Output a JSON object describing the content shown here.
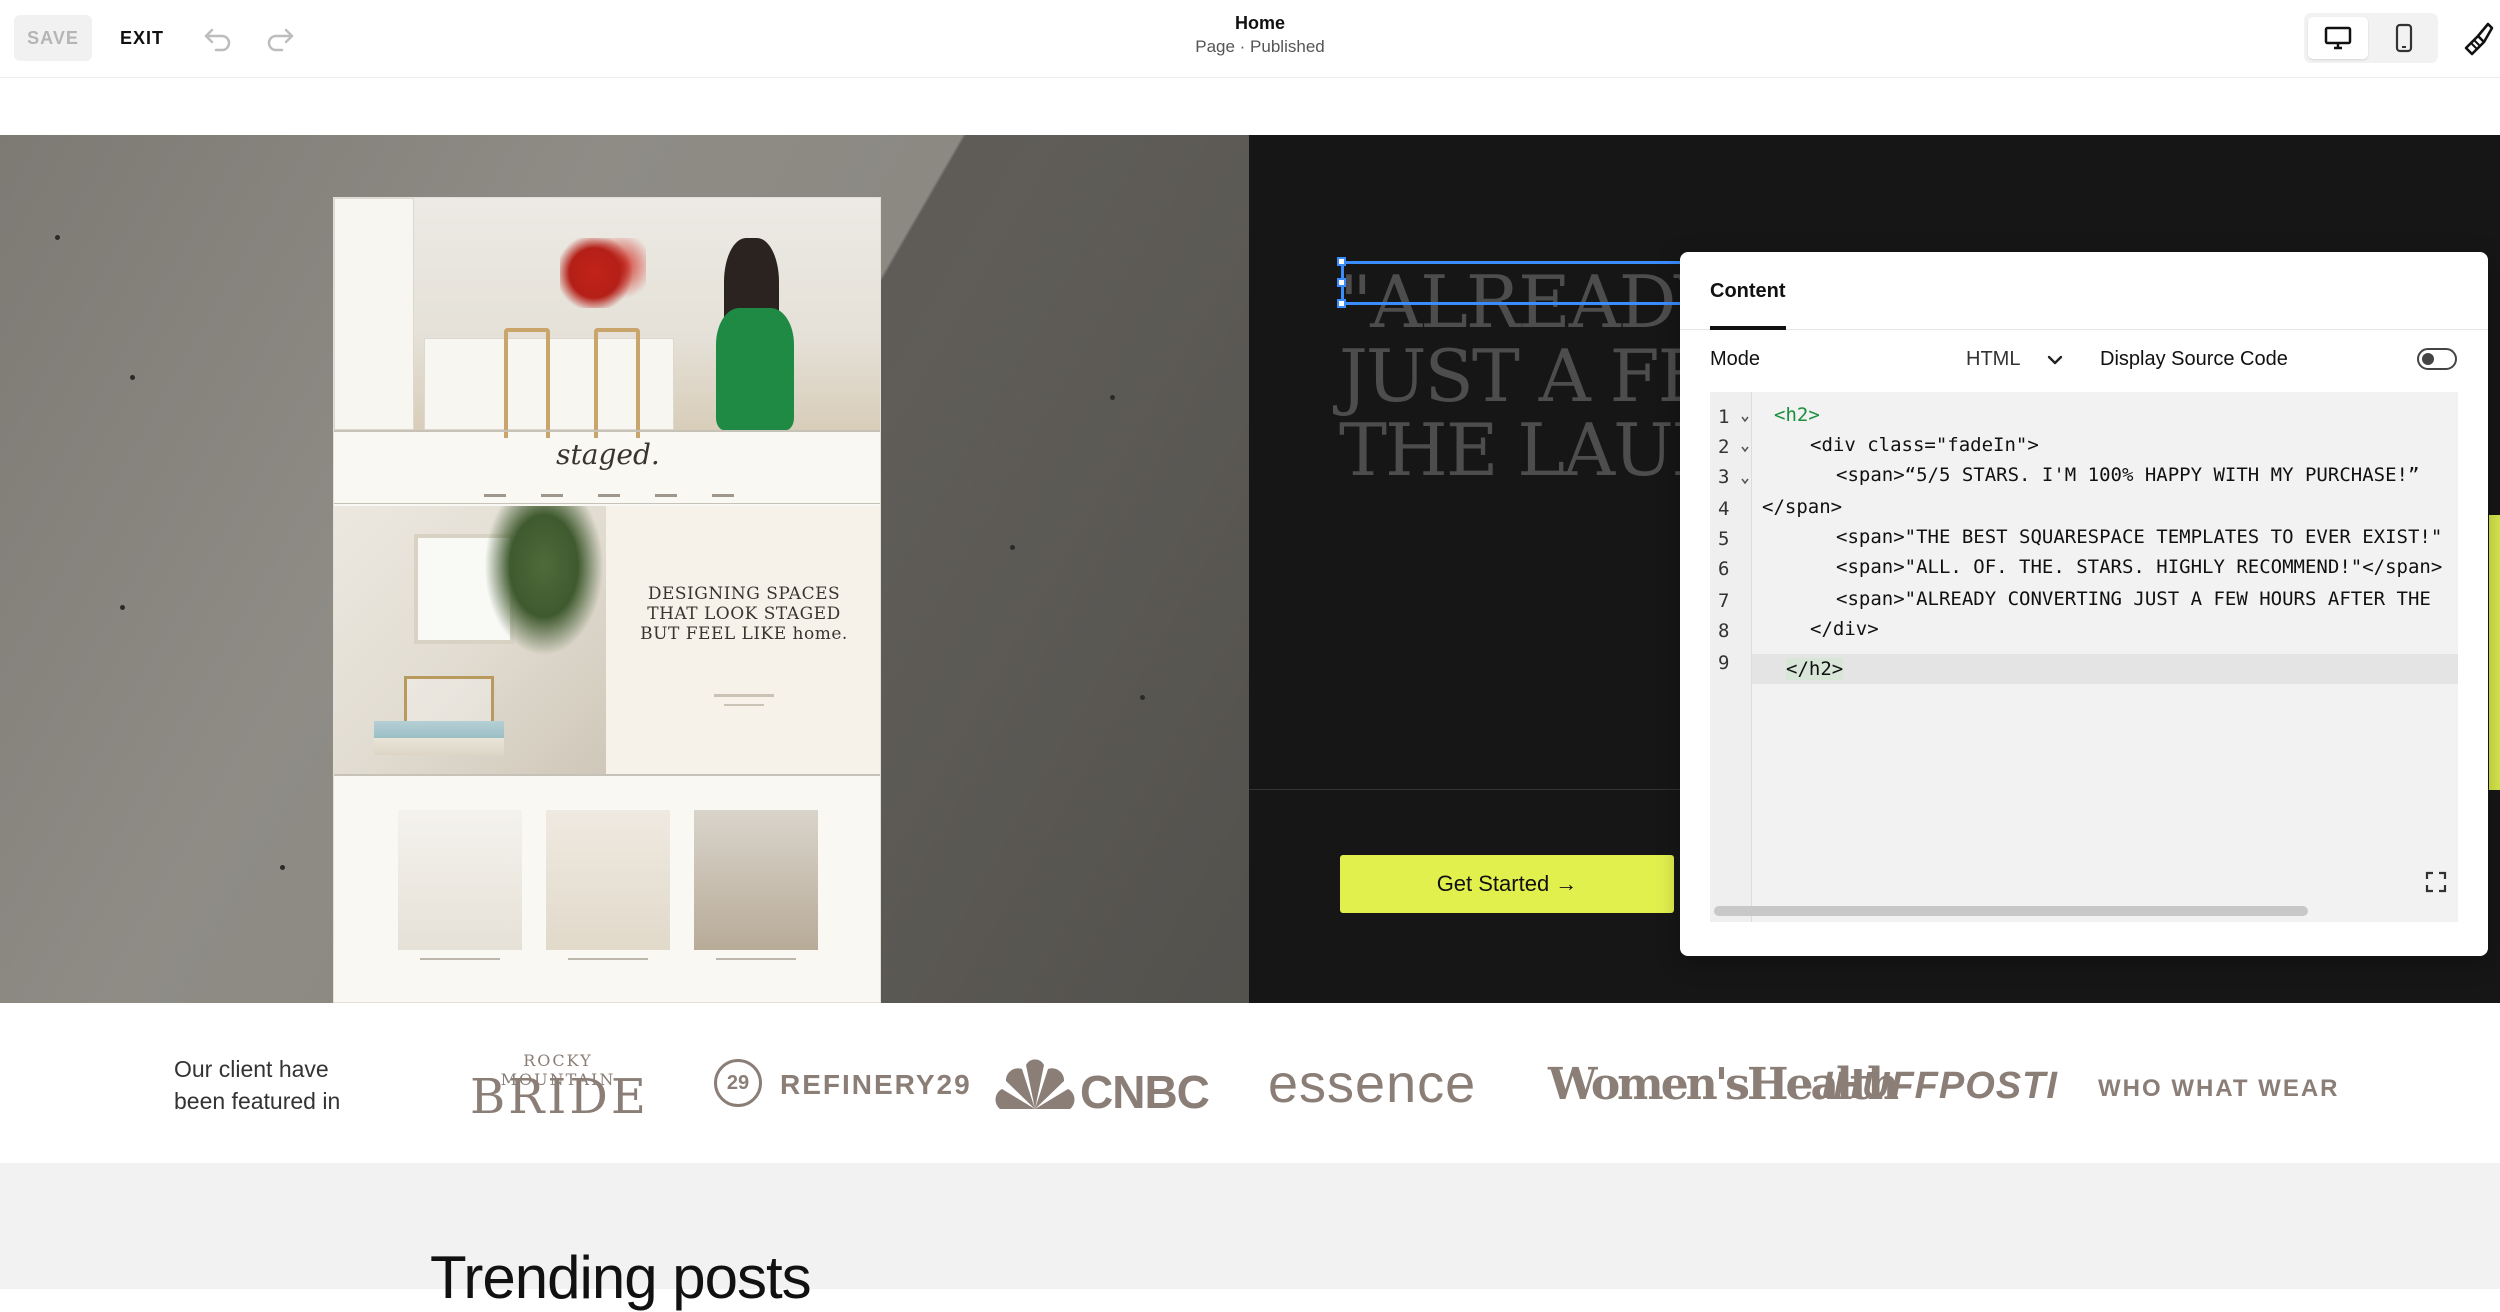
{
  "toolbar": {
    "save_label": "SAVE",
    "exit_label": "EXIT",
    "page_title": "Home",
    "page_status": "Page · Published"
  },
  "hero": {
    "quote": "\"ALREADY\nJUST A FEW\nTHE LAUN",
    "cta_label": "Get Started →",
    "mockup": {
      "logo": "staged.",
      "heading_line1": "DESIGNING SPACES",
      "heading_line2": "THAT LOOK STAGED",
      "heading_line3": "BUT FEEL LIKE home."
    }
  },
  "panel": {
    "tab": "Content",
    "mode_label": "Mode",
    "mode_value": "HTML",
    "source_label": "Display Source Code",
    "source_enabled": false,
    "line_numbers": [
      "1",
      "2",
      "3",
      "4",
      "5",
      "6",
      "7",
      "8",
      "9"
    ],
    "code": [
      "<h2>",
      "<div class=\"fadeIn\">",
      "<span>“5/5 STARS. I'M 100% HAPPY WITH MY PURCHASE!”",
      "</span>",
      "<span>\"THE BEST SQUARESPACE TEMPLATES TO EVER EXIST!\"",
      "<span>\"ALL. OF. THE. STARS. HIGHLY RECOMMEND!\"</span>",
      "<span>\"ALREADY CONVERTING JUST A FEW HOURS AFTER THE",
      "</div>",
      "</h2>"
    ]
  },
  "featured": {
    "label": "Our client have been featured in",
    "logos": {
      "bride_top": "ROCKY MOUNTAIN",
      "bride": "BRIDE",
      "r29_mark": "29",
      "r29": "REFINERY29",
      "cnbc": "CNBC",
      "essence": "essence",
      "womens_health": "Women'sHealth",
      "huffpost": "IHUFFPOSTI",
      "whowhatwear": "WHO WHAT WEAR"
    }
  },
  "trending": {
    "title": "Trending posts"
  },
  "colors": {
    "accent": "#e2f04e",
    "selection": "#3a8dff",
    "logo_gray": "#8a7e77",
    "hero_dark": "#161616"
  },
  "icons": [
    "undo-icon",
    "redo-icon",
    "desktop-icon",
    "mobile-icon",
    "brush-icon",
    "chevron-down-icon",
    "expand-icon",
    "arrow-right-icon"
  ]
}
